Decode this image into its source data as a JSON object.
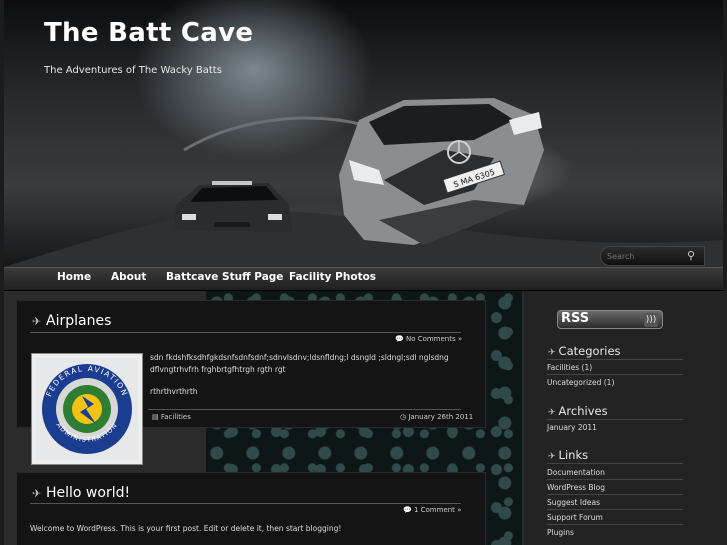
{
  "header": {
    "site_title": "The Batt Cave",
    "site_description": "The Adventures of The Wacky Batts",
    "search_placeholder": "Search",
    "plate_text": "S MA 6305"
  },
  "nav": [
    {
      "label": "Home"
    },
    {
      "label": "About"
    },
    {
      "label": "Battcave Stuff Page"
    },
    {
      "label": "Facility Photos"
    }
  ],
  "posts": [
    {
      "title": "Airplanes",
      "comments": "No Comments »",
      "body_line1": "sdn fkdshfksdhfgkdsnfsdnfsdnf;sdnvlsdnv;ldsnfldng;l dsngld ;sldngl;sdl nglsdng",
      "body_line2": "dflvngtrhvfrh frghbrtgfhtrgh rgth rgt",
      "body_line3": "rthrthvrthrth",
      "category": "Facilities",
      "date": "January 26th 2011",
      "image_text_top": "FEDERAL AVIATION",
      "image_text_bottom": "ADMINISTRATION"
    },
    {
      "title": "Hello world!",
      "comments": "1 Comment »",
      "body_line1": "Welcome to WordPress. This is your first post. Edit or delete it, then start blogging!"
    }
  ],
  "sidebar": {
    "rss_label": "RSS",
    "categories": {
      "title": "Categories",
      "items": [
        {
          "label": "Facilities",
          "count": "(1)"
        },
        {
          "label": "Uncategorized",
          "count": "(1)"
        }
      ]
    },
    "archives": {
      "title": "Archives",
      "items": [
        {
          "label": "January 2011"
        }
      ]
    },
    "links": {
      "title": "Links",
      "items": [
        {
          "label": "Documentation"
        },
        {
          "label": "WordPress Blog"
        },
        {
          "label": "Suggest Ideas"
        },
        {
          "label": "Support Forum"
        },
        {
          "label": "Plugins"
        }
      ]
    }
  },
  "colors": {
    "background": "#1c1c1c",
    "post_background": "#141414",
    "text": "#dddddd"
  }
}
